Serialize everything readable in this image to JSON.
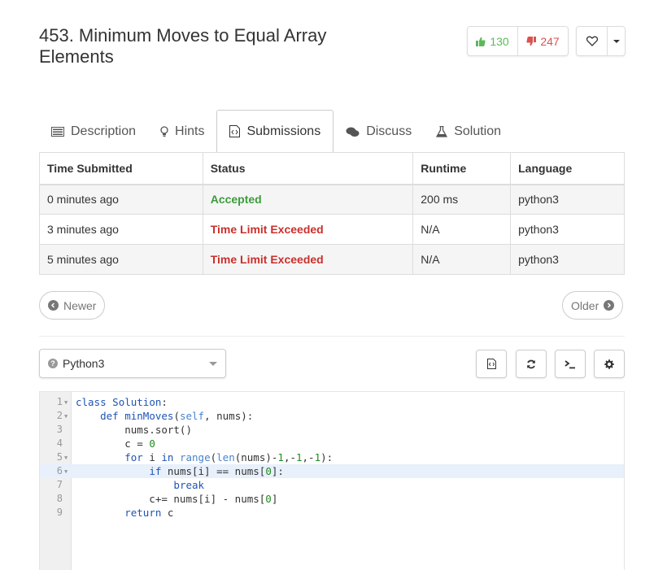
{
  "problem": {
    "title": "453. Minimum Moves to Equal Array Elements",
    "upvotes": "130",
    "downvotes": "247"
  },
  "tabs": [
    {
      "label": "Description",
      "icon": "list-icon"
    },
    {
      "label": "Hints",
      "icon": "lightbulb-icon"
    },
    {
      "label": "Submissions",
      "icon": "code-file-icon",
      "active": true
    },
    {
      "label": "Discuss",
      "icon": "comments-icon"
    },
    {
      "label": "Solution",
      "icon": "flask-icon"
    }
  ],
  "table": {
    "headers": [
      "Time Submitted",
      "Status",
      "Runtime",
      "Language"
    ],
    "rows": [
      {
        "time": "0 minutes ago",
        "status": "Accepted",
        "runtime": "200 ms",
        "language": "python3"
      },
      {
        "time": "3 minutes ago",
        "status": "Time Limit Exceeded",
        "runtime": "N/A",
        "language": "python3"
      },
      {
        "time": "5 minutes ago",
        "status": "Time Limit Exceeded",
        "runtime": "N/A",
        "language": "python3"
      }
    ]
  },
  "pager": {
    "newer": "Newer",
    "older": "Older"
  },
  "editor": {
    "language": "Python3",
    "lines": [
      "class Solution:",
      "    def minMoves(self, nums):",
      "        nums.sort()",
      "        c = 0",
      "        for i in range(len(nums)-1,-1,-1):",
      "            if nums[i] == nums[0]:",
      "                break",
      "            c+= nums[i] - nums[0]",
      "        return c"
    ],
    "line_numbers": [
      "1",
      "2",
      "3",
      "4",
      "5",
      "6",
      "7",
      "8",
      "9"
    ]
  },
  "colors": {
    "accepted": "#3c9c3c",
    "tle": "#c9302c",
    "upvote": "#5cb85c",
    "downvote": "#d9534f"
  }
}
